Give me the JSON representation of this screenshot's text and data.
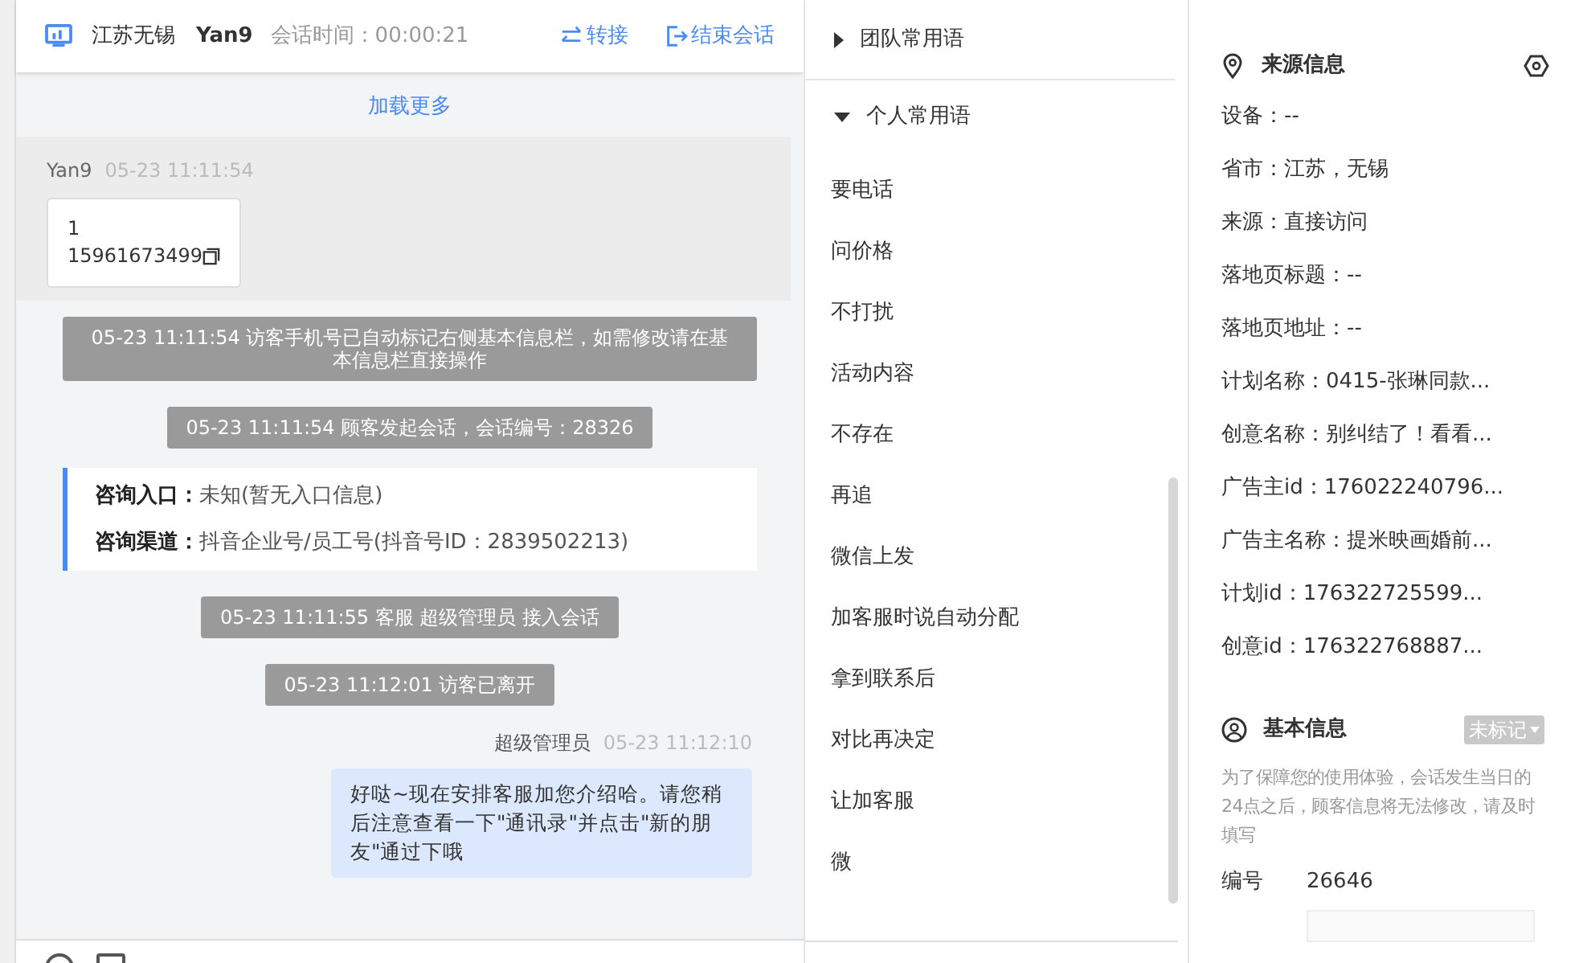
{
  "header": {
    "location": "江苏无锡",
    "visitor": "Yan9",
    "session_label": "会话时间：",
    "session_time": "00:00:21",
    "actions": [
      {
        "kind": "transfer",
        "label": "转接"
      },
      {
        "kind": "end",
        "label": "结束会话"
      }
    ]
  },
  "load_more": "加载更多",
  "messages": [
    {
      "kind": "visitor",
      "sender": "Yan9",
      "time": "05-23 11:11:54",
      "lines": [
        "1",
        "15961673499"
      ]
    },
    {
      "kind": "system",
      "text": "05-23 11:11:54 访客手机号已自动标记右侧基本信息栏，如需修改请在基本信息栏直接操作"
    },
    {
      "kind": "system",
      "text": "05-23 11:11:54 顾客发起会话，会话编号：28326"
    },
    {
      "kind": "entry_info",
      "rows": [
        {
          "label": "咨询入口：",
          "value": "未知(暂无入口信息)"
        },
        {
          "label": "咨询渠道：",
          "value": "抖音企业号/员工号(抖音号ID：2839502213)"
        }
      ]
    },
    {
      "kind": "system",
      "text": "05-23 11:11:55 客服 超级管理员 接入会话"
    },
    {
      "kind": "system",
      "text": "05-23 11:12:01 访客已离开"
    },
    {
      "kind": "agent",
      "sender": "超级管理员",
      "time": "05-23 11:12:10",
      "text": "好哒~现在安排客服加您介绍哈。请您稍后注意查看一下\"通讯录\"并点击\"新的朋友\"通过下哦"
    }
  ],
  "quick_phrases": [
    {
      "title": "团队常用语",
      "expanded": false
    },
    {
      "title": "个人常用语",
      "expanded": true,
      "items": [
        "要电话",
        "问价格",
        "不打扰",
        "活动内容",
        "不存在",
        "再追",
        "微信上发",
        "加客服时说自动分配",
        "拿到联系后",
        "对比再决定",
        "让加客服",
        "微"
      ]
    }
  ],
  "source_info": {
    "title": "来源信息",
    "items": [
      "设备：--",
      "省市：江苏，无锡",
      "来源：直接访问",
      "落地页标题：--",
      "落地页地址：--",
      "计划名称：0415-张琳同款...",
      "创意名称：别纠结了！看看...",
      "广告主id：176022240796...",
      "广告主名称：提米映画婚前...",
      "计划id：176322725599...",
      "创意id：176322768887..."
    ]
  },
  "basic_info": {
    "title": "基本信息",
    "tag": "未标记",
    "notice": "为了保障您的使用体验，会话发生当日的24点之后，顾客信息将无法修改，请及时填写",
    "fields": [
      {
        "label": "编号",
        "value": "26646"
      }
    ]
  }
}
